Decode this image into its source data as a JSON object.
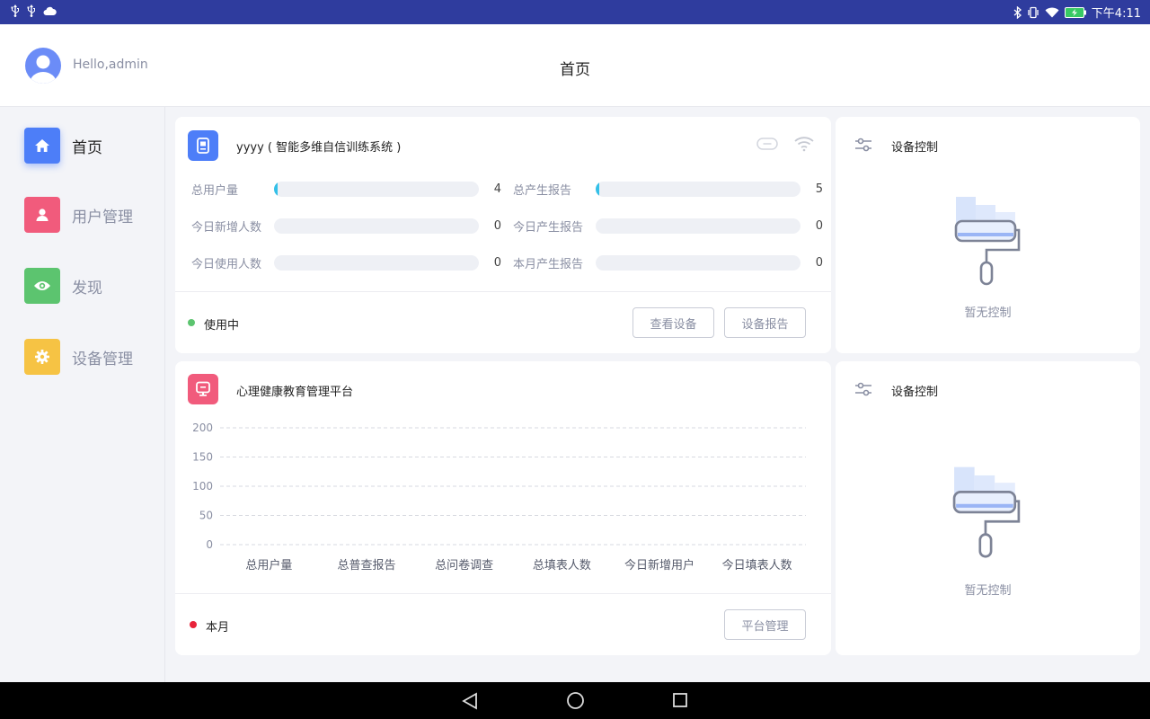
{
  "status_bar": {
    "time": "下午4:11"
  },
  "header": {
    "greeting": "Hello,admin",
    "title": "首页"
  },
  "sidebar": {
    "items": [
      {
        "label": "首页",
        "icon": "home-icon",
        "color": "#4d7ef8",
        "active": true
      },
      {
        "label": "用户管理",
        "icon": "user-icon",
        "color": "#f15b7c",
        "active": false
      },
      {
        "label": "发现",
        "icon": "eye-icon",
        "color": "#5cc46f",
        "active": false
      },
      {
        "label": "设备管理",
        "icon": "gear-icon",
        "color": "#f6c344",
        "active": false
      }
    ]
  },
  "device_card": {
    "icon": "device-icon",
    "title": "yyyy ( 智能多维自信训练系统 )",
    "stats_left": [
      {
        "label": "总用户量",
        "value": 4,
        "fill": 0.01
      },
      {
        "label": "今日新增人数",
        "value": 0,
        "fill": 0
      },
      {
        "label": "今日使用人数",
        "value": 0,
        "fill": 0
      }
    ],
    "stats_right": [
      {
        "label": "总产生报告",
        "value": 5,
        "fill": 0.01
      },
      {
        "label": "今日产生报告",
        "value": 0,
        "fill": 0
      },
      {
        "label": "本月产生报告",
        "value": 0,
        "fill": 0
      }
    ],
    "status": "使用中",
    "status_color": "#5cc46f",
    "buttons": {
      "view": "查看设备",
      "report": "设备报告"
    }
  },
  "platform_card": {
    "icon": "monitor-icon",
    "title": "心理健康教育管理平台",
    "legend": "本月",
    "legend_color": "#e8233a",
    "button": "平台管理"
  },
  "control_cards": [
    {
      "title": "设备控制",
      "empty_text": "暂无控制"
    },
    {
      "title": "设备控制",
      "empty_text": "暂无控制"
    }
  ],
  "chart_data": {
    "type": "bar",
    "categories": [
      "总用户量",
      "总普查报告",
      "总问卷调查",
      "总填表人数",
      "今日新增用户",
      "今日填表人数"
    ],
    "series": [
      {
        "name": "本月",
        "values": [
          0,
          0,
          0,
          0,
          0,
          0
        ]
      }
    ],
    "yticks": [
      "200",
      "150",
      "100",
      "50",
      "0"
    ],
    "ylim": [
      0,
      200
    ],
    "grid": true,
    "legend_position": "bottom-left"
  }
}
